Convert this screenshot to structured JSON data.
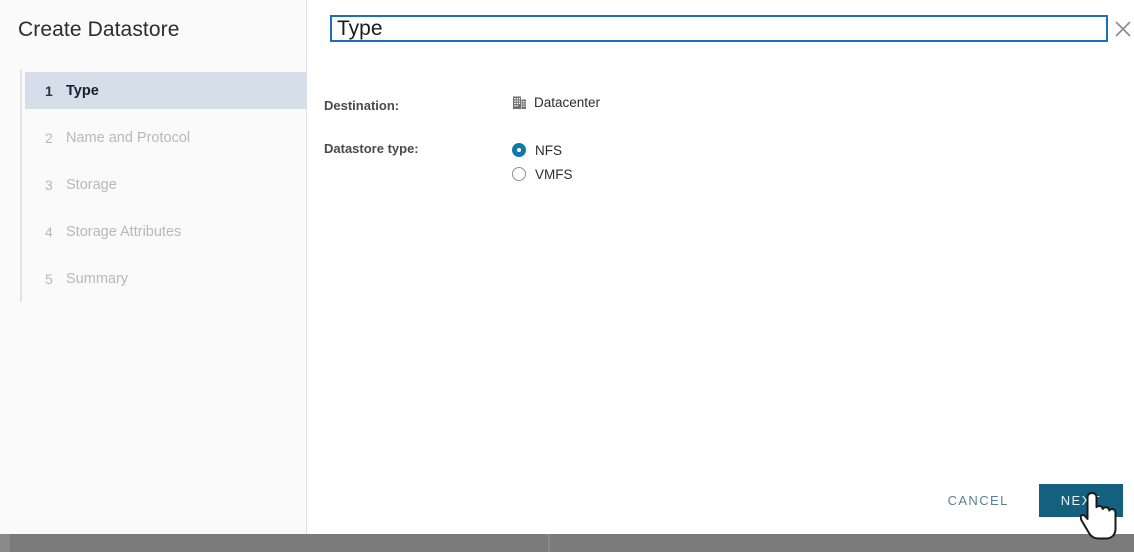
{
  "wizard": {
    "title": "Create Datastore",
    "steps": [
      {
        "num": "1",
        "label": "Type",
        "active": true
      },
      {
        "num": "2",
        "label": "Name and Protocol",
        "active": false
      },
      {
        "num": "3",
        "label": "Storage",
        "active": false
      },
      {
        "num": "4",
        "label": "Storage Attributes",
        "active": false
      },
      {
        "num": "5",
        "label": "Summary",
        "active": false
      }
    ]
  },
  "content": {
    "heading": "Type",
    "close_icon": "close-icon"
  },
  "form": {
    "destination": {
      "label": "Destination:",
      "icon": "datacenter-icon",
      "value": "Datacenter"
    },
    "datastore_type": {
      "label": "Datastore type:",
      "options": [
        {
          "label": "NFS",
          "selected": true
        },
        {
          "label": "VMFS",
          "selected": false
        }
      ]
    }
  },
  "footer": {
    "cancel_label": "CANCEL",
    "next_label": "NEXT"
  },
  "colors": {
    "accent_blue": "#1f6cb8",
    "radio_selected": "#0f7aa8",
    "primary_button": "#14607f",
    "cancel_text": "#5b7f97",
    "step_active_bg": "#d6dfe9",
    "sidebar_bg": "#fafafa",
    "bottom_bar": "#7b7b7b"
  }
}
